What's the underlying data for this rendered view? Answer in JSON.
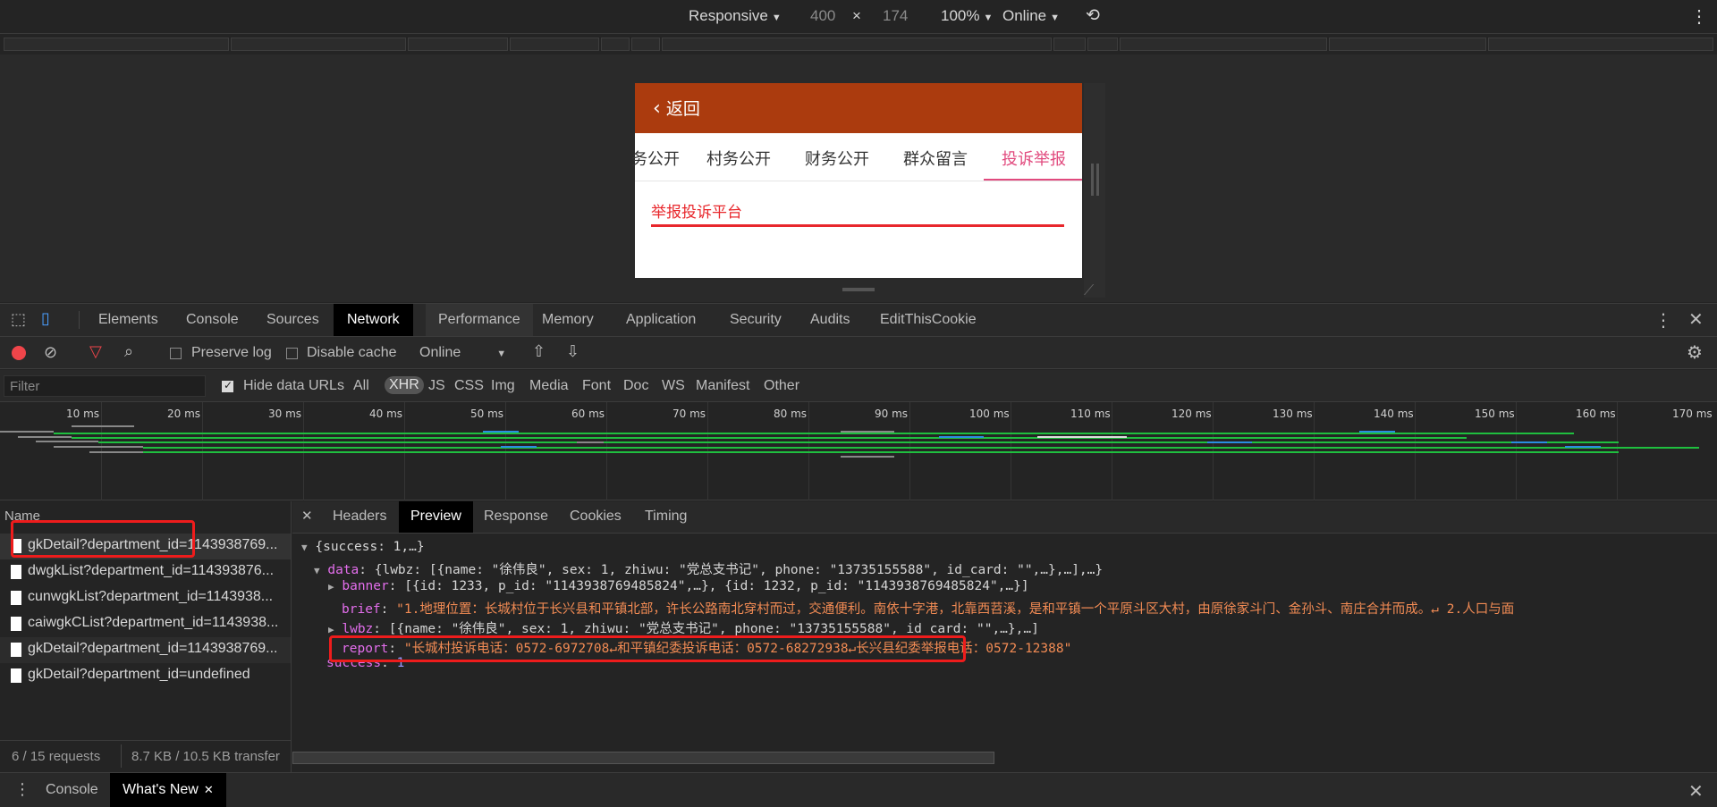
{
  "device_toolbar": {
    "mode": "Responsive",
    "width": "400",
    "times": "×",
    "height": "174",
    "zoom": "100%",
    "throttle": "Online"
  },
  "mobile_page": {
    "back_label": "返回",
    "tabs": [
      "务公开",
      "村务公开",
      "财务公开",
      "群众留言",
      "投诉举报"
    ],
    "active_tab": "投诉举报",
    "section_title": "举报投诉平台"
  },
  "devtools_tabs": [
    "Elements",
    "Console",
    "Sources",
    "Network",
    "Performance",
    "Memory",
    "Application",
    "Security",
    "Audits",
    "EditThisCookie"
  ],
  "active_devtools_tab": "Network",
  "network_toolbar": {
    "preserve_log": "Preserve log",
    "disable_cache": "Disable cache",
    "throttle": "Online"
  },
  "filter_bar": {
    "placeholder": "Filter",
    "hide_data_urls": "Hide data URLs",
    "types": [
      "All",
      "XHR",
      "JS",
      "CSS",
      "Img",
      "Media",
      "Font",
      "Doc",
      "WS",
      "Manifest",
      "Other"
    ],
    "selected_type": "XHR"
  },
  "timeline": {
    "ticks": [
      "10 ms",
      "20 ms",
      "30 ms",
      "40 ms",
      "50 ms",
      "60 ms",
      "70 ms",
      "80 ms",
      "90 ms",
      "100 ms",
      "110 ms",
      "120 ms",
      "130 ms",
      "140 ms",
      "150 ms",
      "160 ms",
      "170 ms"
    ]
  },
  "request_list": {
    "header": "Name",
    "items": [
      "gkDetail?department_id=1143938769...",
      "dwgkList?department_id=114393876...",
      "cunwgkList?department_id=1143938...",
      "caiwgkCList?department_id=1143938...",
      "gkDetail?department_id=1143938769...",
      "gkDetail?department_id=undefined"
    ],
    "requests_count": "6 / 15 requests",
    "transfer": "8.7 KB / 10.5 KB transfer"
  },
  "preview_tabs": [
    "Headers",
    "Preview",
    "Response",
    "Cookies",
    "Timing"
  ],
  "active_preview_tab": "Preview",
  "preview": {
    "line1": "{success: 1,…}",
    "data_key": "data",
    "data_val": ": {lwbz: [{name: \"徐伟良\", sex: 1, zhiwu: \"党总支书记\", phone: \"13735155588\", id_card: \"\",…},…],…}",
    "banner_key": "banner",
    "banner_val": ": [{id: 1233, p_id: \"1143938769485824\",…}, {id: 1232, p_id: \"1143938769485824\",…}]",
    "brief_key": "brief",
    "brief_val": "\"1.地理位置：长城村位于长兴县和平镇北部，许长公路南北穿村而过，交通便利。南依十字港，北靠西苕溪，是和平镇一个平原斗区大村，由原徐家斗门、金孙斗、南庄合并而成。↵    2.人口与面",
    "lwbz_key": "lwbz",
    "lwbz_val": ": [{name: \"徐伟良\", sex: 1, zhiwu: \"党总支书记\", phone: \"13735155588\", id_card: \"\",…},…]",
    "report_key": "report",
    "report_val": "\"长城村投诉电话：0572-6972708↵和平镇纪委投诉电话：0572-68272938↵长兴县纪委举报电话：0572-12388\"",
    "success_key": "success",
    "success_val": "1"
  },
  "drawer": {
    "tabs": [
      "Console",
      "What's New"
    ],
    "active": "What's New"
  },
  "colors": {
    "annotation_red": "#ee1c1c",
    "header_bar": "#ab3b0e",
    "active_tab_pink": "#e14a7e"
  }
}
